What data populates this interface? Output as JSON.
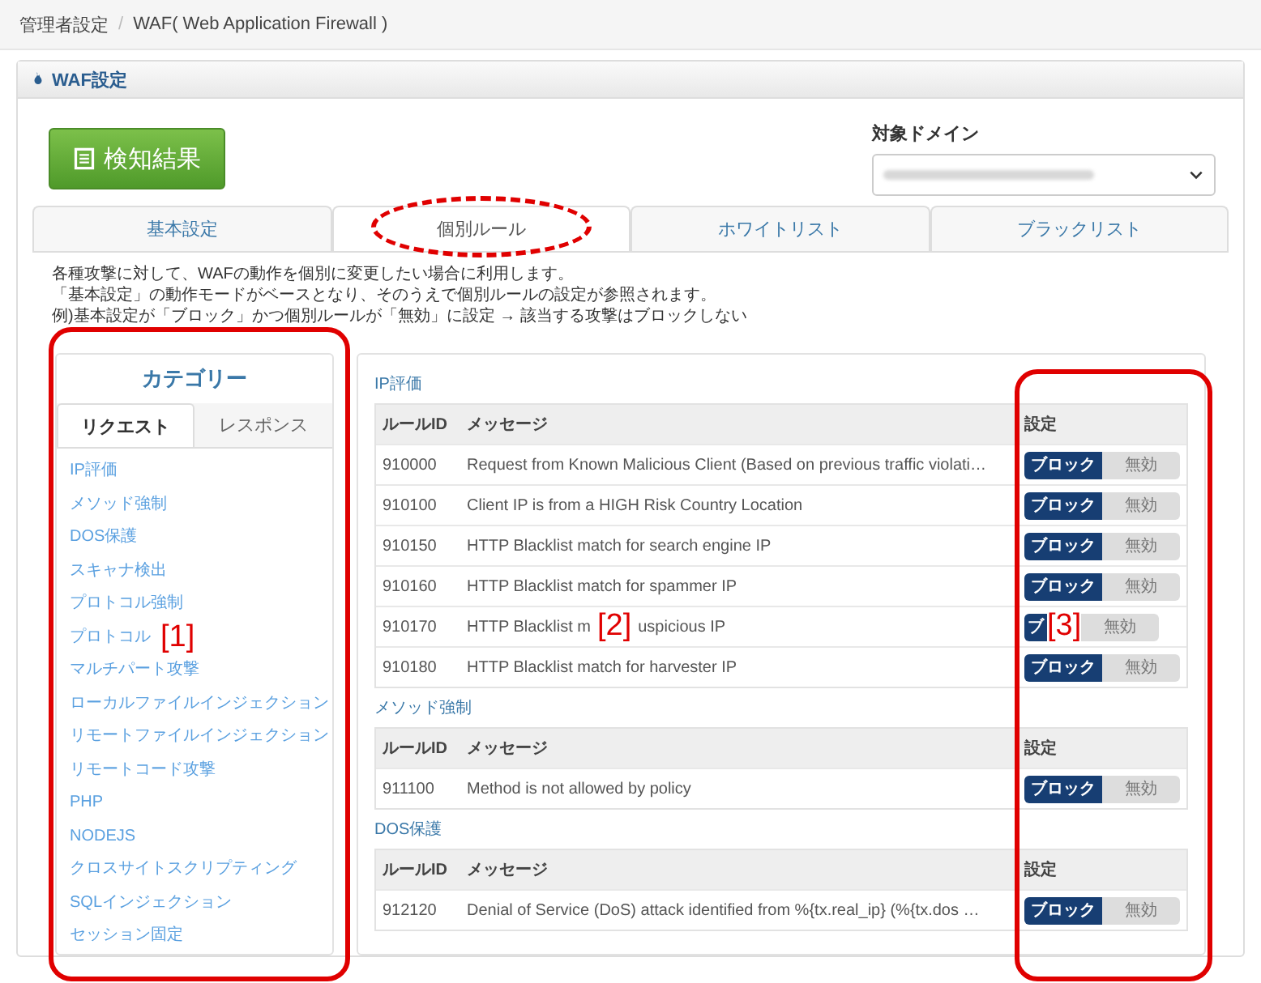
{
  "breadcrumb_separator": "/",
  "breadcrumb": [
    {
      "label": "管理者設定"
    },
    {
      "label": "WAF( Web Application Firewall )"
    }
  ],
  "panel": {
    "title": "WAF設定"
  },
  "detect_button": {
    "label": "検知結果"
  },
  "domain": {
    "label": "対象ドメイン"
  },
  "tabs": [
    {
      "label": "基本設定",
      "selected": false
    },
    {
      "label": "個別ルール",
      "selected": true
    },
    {
      "label": "ホワイトリスト",
      "selected": false
    },
    {
      "label": "ブラックリスト",
      "selected": false
    }
  ],
  "description": [
    "各種攻撃に対して、WAFの動作を個別に変更したい場合に利用します。",
    "「基本設定」の動作モードがベースとなり、そのうえで個別ルールの設定が参照されます。",
    "例)基本設定が「ブロック」かつ個別ルールが「無効」に設定 → 該当する攻撃はブロックしない"
  ],
  "category": {
    "title": "カテゴリー",
    "tabs": [
      {
        "label": "リクエスト",
        "selected": true
      },
      {
        "label": "レスポンス",
        "selected": false
      }
    ],
    "items": [
      {
        "label": "IP評価"
      },
      {
        "label": "メソッド強制"
      },
      {
        "label": "DOS保護"
      },
      {
        "label": "スキャナ検出"
      },
      {
        "label": "プロトコル強制"
      },
      {
        "label": "プロトコル",
        "note": "[1]"
      },
      {
        "label": "マルチパート攻撃"
      },
      {
        "label": "ローカルファイルインジェクション"
      },
      {
        "label": "リモートファイルインジェクション"
      },
      {
        "label": "リモートコード攻撃"
      },
      {
        "label": "PHP"
      },
      {
        "label": "NODEJS"
      },
      {
        "label": "クロスサイトスクリプティング"
      },
      {
        "label": "SQLインジェクション"
      },
      {
        "label": "セッション固定"
      }
    ]
  },
  "sections": [
    {
      "title": "IP評価",
      "columns": [
        "ルールID",
        "メッセージ",
        "設定"
      ],
      "rows": [
        {
          "id": "910000",
          "message": "Request from Known Malicious Client (Based on previous traffic violati…",
          "options": [
            {
              "label": "ブロック",
              "selected": true
            },
            {
              "label": "無効",
              "selected": false
            }
          ]
        },
        {
          "id": "910100",
          "message": "Client IP is from a HIGH Risk Country Location",
          "options": [
            {
              "label": "ブロック",
              "selected": true
            },
            {
              "label": "無効",
              "selected": false
            }
          ]
        },
        {
          "id": "910150",
          "message": "HTTP Blacklist match for search engine IP",
          "options": [
            {
              "label": "ブロック",
              "selected": true
            },
            {
              "label": "無効",
              "selected": false
            }
          ]
        },
        {
          "id": "910160",
          "message": "HTTP Blacklist match for spammer IP",
          "options": [
            {
              "label": "ブロック",
              "selected": true
            },
            {
              "label": "無効",
              "selected": false
            }
          ]
        },
        {
          "id": "910170",
          "message": "HTTP Blacklist m",
          "note": "[2]",
          "message_tail": "uspicious IP",
          "option_note": "[3]",
          "options": [
            {
              "label": "ブ",
              "selected": true
            },
            {
              "label": "無効",
              "selected": false
            }
          ]
        },
        {
          "id": "910180",
          "message": "HTTP Blacklist match for harvester IP",
          "options": [
            {
              "label": "ブロック",
              "selected": true
            },
            {
              "label": "無効",
              "selected": false
            }
          ]
        }
      ]
    },
    {
      "title": "メソッド強制",
      "columns": [
        "ルールID",
        "メッセージ",
        "設定"
      ],
      "rows": [
        {
          "id": "911100",
          "message": "Method is not allowed by policy",
          "options": [
            {
              "label": "ブロック",
              "selected": true
            },
            {
              "label": "無効",
              "selected": false
            }
          ]
        }
      ]
    },
    {
      "title": "DOS保護",
      "columns": [
        "ルールID",
        "メッセージ",
        "設定"
      ],
      "rows": [
        {
          "id": "912120",
          "message": "Denial of Service (DoS) attack identified from %{tx.real_ip} (%{tx.dos …",
          "options": [
            {
              "label": "ブロック",
              "selected": true
            },
            {
              "label": "無効",
              "selected": false
            }
          ]
        }
      ]
    }
  ]
}
